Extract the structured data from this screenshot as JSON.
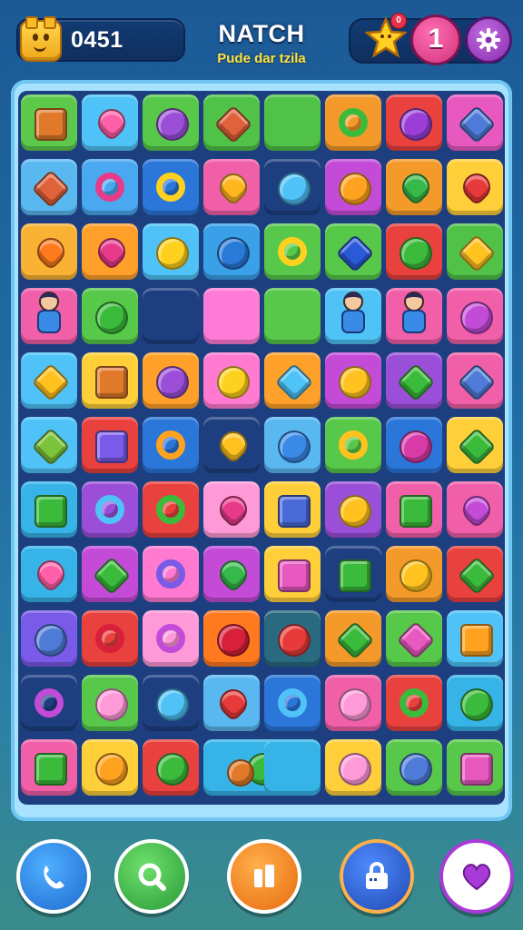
{
  "header": {
    "score": "0451",
    "title": "NATCH",
    "subtitle": "Pude dar tzila",
    "star_badge": "0",
    "lives": "1"
  },
  "icons": {
    "score": "smiley-block-icon",
    "star": "star-icon",
    "settings": "gear-icon"
  },
  "colors": {
    "background": "#1f6aa3",
    "board_frame": "#a8e2ff",
    "title": "#ffffff",
    "subtitle": "#ffe33a"
  },
  "board": {
    "columns": 8,
    "rows": 11,
    "tiles": [
      {
        "c": "#5cc94a",
        "g": "#e07a2a",
        "s": "sq"
      },
      {
        "c": "#4fc3f7",
        "g": "#ff5fa8",
        "s": "heart"
      },
      {
        "c": "#57c84a",
        "g": "#9b4fd8",
        "s": "gem"
      },
      {
        "c": "#4fc247",
        "g": "#e0623a",
        "s": "diamond"
      },
      {
        "c": "#4fc247",
        "g": "",
        "s": "none"
      },
      {
        "c": "#f39a2a",
        "g": "#3bbb3b",
        "s": "ring"
      },
      {
        "c": "#e9413e",
        "g": "#9b3fd8",
        "s": "gem"
      },
      {
        "c": "#e859c0",
        "g": "#4e7bd8",
        "s": "diamond"
      },
      {
        "c": "#5ab8f0",
        "g": "#e0623a",
        "s": "diamond"
      },
      {
        "c": "#49a8f0",
        "g": "#e83a8a",
        "s": "ring"
      },
      {
        "c": "#2a76d9",
        "g": "#ffd11f",
        "s": "ring"
      },
      {
        "c": "#f05fa8",
        "g": "#ffb61f",
        "s": "heart"
      },
      {
        "c": "#1d3f80",
        "g": "#4fc3f7",
        "s": "gem"
      },
      {
        "c": "#c34bd8",
        "g": "#ffa21f",
        "s": "gem"
      },
      {
        "c": "#f39a2a",
        "g": "#36b84a",
        "s": "heart"
      },
      {
        "c": "#ffcf3a",
        "g": "#e83a3a",
        "s": "heart"
      },
      {
        "c": "#f9b233",
        "g": "#ff7a1f",
        "s": "heart"
      },
      {
        "c": "#ffa02a",
        "g": "#e83a8a",
        "s": "heart"
      },
      {
        "c": "#4fc3f7",
        "g": "#ffd11f",
        "s": "gem"
      },
      {
        "c": "#3aa1e8",
        "g": "#2a7ad9",
        "s": "gem"
      },
      {
        "c": "#57c84a",
        "g": "#ffd11f",
        "s": "ring"
      },
      {
        "c": "#57c84a",
        "g": "#2a5ad9",
        "s": "diamond"
      },
      {
        "c": "#e9413e",
        "g": "#3bbb3b",
        "s": "gem"
      },
      {
        "c": "#4fc247",
        "g": "#ffc21f",
        "s": "diamond"
      },
      {
        "c": "#f05fa8",
        "g": "#",
        "s": "char"
      },
      {
        "c": "#57c84a",
        "g": "#3bbb3b",
        "s": "big"
      },
      {
        "c": "#1d3f80",
        "g": "",
        "s": "none"
      },
      {
        "c": "#ff7bd5",
        "g": "",
        "s": "none"
      },
      {
        "c": "#57c84a",
        "g": "",
        "s": "none"
      },
      {
        "c": "#4fc3f7",
        "g": "#",
        "s": "char"
      },
      {
        "c": "#f05fa8",
        "g": "#",
        "s": "char"
      },
      {
        "c": "#f05fa8",
        "g": "#c34bd8",
        "s": "big"
      },
      {
        "c": "#4fc3f7",
        "g": "#ffc21f",
        "s": "diamond"
      },
      {
        "c": "#ffcf3a",
        "g": "#e07a2a",
        "s": "sq"
      },
      {
        "c": "#ffa02a",
        "g": "#9b4fd8",
        "s": "gem"
      },
      {
        "c": "#ff7ad0",
        "g": "#ffd11f",
        "s": "gem"
      },
      {
        "c": "#ffa02a",
        "g": "#4fc3f7",
        "s": "diamond"
      },
      {
        "c": "#c34bd8",
        "g": "#ffc21f",
        "s": "gem"
      },
      {
        "c": "#9b4fd8",
        "g": "#3bbb3b",
        "s": "diamond"
      },
      {
        "c": "#f05fa8",
        "g": "#4e7bd8",
        "s": "diamond"
      },
      {
        "c": "#4fc3f7",
        "g": "#7bc33a",
        "s": "diamond"
      },
      {
        "c": "#e9413e",
        "g": "#7a5ae8",
        "s": "sq"
      },
      {
        "c": "#2a76d9",
        "g": "#ffa21f",
        "s": "ring"
      },
      {
        "c": "#1d3f80",
        "g": "#ffc21f",
        "s": "heart"
      },
      {
        "c": "#5ab8f0",
        "g": "#3a8ae8",
        "s": "gem"
      },
      {
        "c": "#57c84a",
        "g": "#ffc21f",
        "s": "ring"
      },
      {
        "c": "#2a76d9",
        "g": "#d83aa8",
        "s": "gem"
      },
      {
        "c": "#ffcf3a",
        "g": "#3bbb3b",
        "s": "diamond"
      },
      {
        "c": "#36b4e8",
        "g": "#3bbb3b",
        "s": "sq"
      },
      {
        "c": "#9b4fd8",
        "g": "#4fc3f7",
        "s": "ring"
      },
      {
        "c": "#e9413e",
        "g": "#3bbb3b",
        "s": "ring"
      },
      {
        "c": "#ff9ad8",
        "g": "#e83a8a",
        "s": "heart"
      },
      {
        "c": "#ffcf3a",
        "g": "#4a6ad8",
        "s": "sq"
      },
      {
        "c": "#9b4fd8",
        "g": "#ffc21f",
        "s": "gem"
      },
      {
        "c": "#f05fa8",
        "g": "#3bbb3b",
        "s": "sq"
      },
      {
        "c": "#f05fa8",
        "g": "#c34bd8",
        "s": "heart"
      },
      {
        "c": "#36b4e8",
        "g": "#ff5fa8",
        "s": "heart"
      },
      {
        "c": "#c34bd8",
        "g": "#3bbb3b",
        "s": "diamond"
      },
      {
        "c": "#ff7ad0",
        "g": "#7a5ae8",
        "s": "ring"
      },
      {
        "c": "#c34bd8",
        "g": "#36b84a",
        "s": "heart"
      },
      {
        "c": "#ffcf3a",
        "g": "#e859c0",
        "s": "sq"
      },
      {
        "c": "#1d3f80",
        "g": "#3bbb3b",
        "s": "sq"
      },
      {
        "c": "#f39a2a",
        "g": "#ffc21f",
        "s": "gem"
      },
      {
        "c": "#e9413e",
        "g": "#3bbb3b",
        "s": "diamond"
      },
      {
        "c": "#7a5ae8",
        "g": "#4e7bd8",
        "s": "gem"
      },
      {
        "c": "#e9413e",
        "g": "#d8203a",
        "s": "ring"
      },
      {
        "c": "#ff9ad8",
        "g": "#c34bd8",
        "s": "ring"
      },
      {
        "c": "#ff7a1f",
        "g": "#d8203a",
        "s": "gem"
      },
      {
        "c": "#2a6a80",
        "g": "#e83a3a",
        "s": "gem"
      },
      {
        "c": "#f39a2a",
        "g": "#3bbb3b",
        "s": "diamond"
      },
      {
        "c": "#57c84a",
        "g": "#e859c0",
        "s": "diamond"
      },
      {
        "c": "#4fc3f7",
        "g": "#ffa21f",
        "s": "sq"
      },
      {
        "c": "#1d3f80",
        "g": "#c34bd8",
        "s": "ring"
      },
      {
        "c": "#57c84a",
        "g": "#ff9ad8",
        "s": "gem"
      },
      {
        "c": "#1d3f80",
        "g": "#4fc3f7",
        "s": "gem"
      },
      {
        "c": "#5ab8f0",
        "g": "#e83a3a",
        "s": "heart"
      },
      {
        "c": "#2a76d9",
        "g": "#4fc3f7",
        "s": "ring"
      },
      {
        "c": "#f05fa8",
        "g": "#ff9ad8",
        "s": "gem"
      },
      {
        "c": "#e9413e",
        "g": "#3bbb3b",
        "s": "ring"
      },
      {
        "c": "#36b4e8",
        "g": "#3bbb3b",
        "s": "gem"
      },
      {
        "c": "#f05fa8",
        "g": "#3bbb3b",
        "s": "sq"
      },
      {
        "c": "#ffcf3a",
        "g": "#ffa21f",
        "s": "gem"
      },
      {
        "c": "#e9413e",
        "g": "#3bbb3b",
        "s": "gem"
      },
      {
        "c": "#36b4e8",
        "g": "#e07a2a",
        "s": "wide"
      },
      {
        "c": "#36b4e8",
        "g": "",
        "s": "none"
      },
      {
        "c": "#ffcf3a",
        "g": "#ff9ad8",
        "s": "gem"
      },
      {
        "c": "#57c84a",
        "g": "#4e7bd8",
        "s": "gem"
      },
      {
        "c": "#57c84a",
        "g": "#e859c0",
        "s": "sq"
      }
    ]
  },
  "bottom_bar": {
    "buttons": [
      {
        "name": "back-button",
        "icon": "phone-back-icon",
        "color": "#1f8ad8"
      },
      {
        "name": "search-button",
        "icon": "magnifier-icon",
        "color": "#3ab84a"
      },
      {
        "name": "boost-button",
        "icon": "pause-bars-icon",
        "color": "#ff8a1f"
      },
      {
        "name": "shop-button",
        "icon": "lock-bag-icon",
        "color": "#2a5ad9"
      },
      {
        "name": "favorite-button",
        "icon": "heart-icon",
        "color": "#a83ad8"
      }
    ]
  }
}
